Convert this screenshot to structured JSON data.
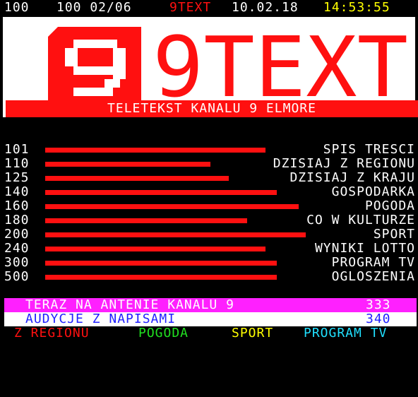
{
  "header": {
    "page": "100",
    "subpage": "100 02/06",
    "channel": "9TEXT",
    "date": "10.02.18",
    "time": "14:53:55"
  },
  "banner": {
    "logo_digit": "9",
    "title": "9TEXT",
    "subtitle": "TELETEKST KANALU 9 ELMORE"
  },
  "index": [
    {
      "page": "101",
      "label": "SPIS TRESCI",
      "bar_fraction": 0.6
    },
    {
      "page": "110",
      "label": "DZISIAJ Z REGIONU",
      "bar_fraction": 0.45
    },
    {
      "page": "125",
      "label": "DZISIAJ Z KRAJU",
      "bar_fraction": 0.5
    },
    {
      "page": "140",
      "label": "GOSPODARKA",
      "bar_fraction": 0.63
    },
    {
      "page": "160",
      "label": "POGODA",
      "bar_fraction": 0.69
    },
    {
      "page": "180",
      "label": "CO W KULTURZE",
      "bar_fraction": 0.55
    },
    {
      "page": "200",
      "label": "SPORT",
      "bar_fraction": 0.71
    },
    {
      "page": "240",
      "label": "WYNIKI LOTTO",
      "bar_fraction": 0.6
    },
    {
      "page": "300",
      "label": "PROGRAM TV",
      "bar_fraction": 0.63
    },
    {
      "page": "500",
      "label": "OGLOSZENIA",
      "bar_fraction": 0.63
    }
  ],
  "promo": [
    {
      "label": "TERAZ NA ANTENIE KANALU 9",
      "page": "333"
    },
    {
      "label": "AUDYCJE Z NAPISAMI",
      "page": "340"
    }
  ],
  "fastext": [
    {
      "label": "Z REGIONU",
      "color": "#ff1010"
    },
    {
      "label": "POGODA",
      "color": "#20e020"
    },
    {
      "label": "SPORT",
      "color": "#ffff00"
    },
    {
      "label": "PROGRAM TV",
      "color": "#20e0ff"
    }
  ],
  "colors": {
    "red": "#ff1010",
    "yellow": "#ffff00",
    "magenta": "#ff20ff",
    "blue": "#2020ff",
    "white": "#ffffff"
  }
}
